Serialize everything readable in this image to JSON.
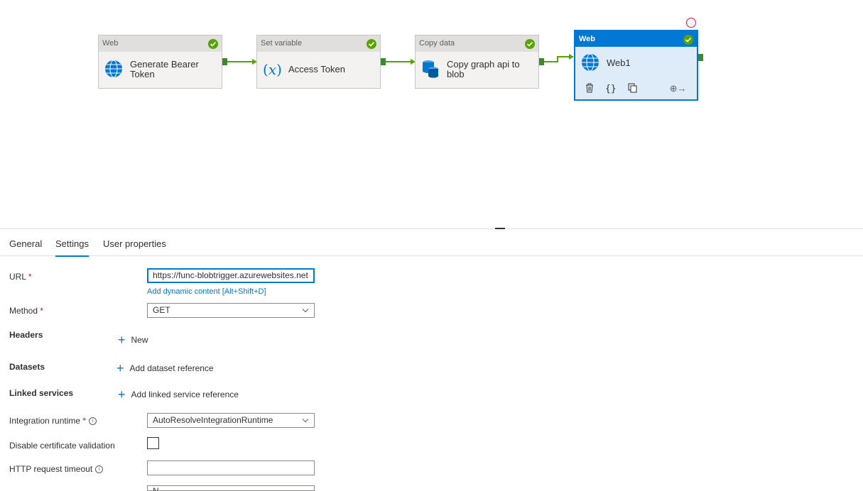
{
  "pipeline": {
    "activities": [
      {
        "type": "Web",
        "name": "Generate Bearer Token",
        "status": "succeeded",
        "icon": "globe-icon"
      },
      {
        "type": "Set variable",
        "name": "Access Token",
        "status": "succeeded",
        "icon": "variable-icon"
      },
      {
        "type": "Copy data",
        "name": "Copy graph api to blob",
        "status": "succeeded",
        "icon": "database-icon"
      },
      {
        "type": "Web",
        "name": "Web1",
        "status": "succeeded",
        "icon": "globe-icon",
        "selected": true
      }
    ],
    "selected_tools": [
      "delete-icon",
      "code-icon",
      "copy-icon",
      "add-output-icon"
    ]
  },
  "tabs": [
    {
      "label": "General"
    },
    {
      "label": "Settings",
      "active": true
    },
    {
      "label": "User properties"
    }
  ],
  "settings": {
    "url": {
      "label": "URL",
      "required": "*",
      "value": "https://func-blobtrigger.azurewebsites.net",
      "dynamic_link": "Add dynamic content [Alt+Shift+D]"
    },
    "method": {
      "label": "Method",
      "required": "*",
      "value": "GET"
    },
    "headers": {
      "label": "Headers",
      "add_label": "New"
    },
    "datasets": {
      "label": "Datasets",
      "add_label": "Add dataset reference"
    },
    "linked_services": {
      "label": "Linked services",
      "add_label": "Add linked service reference"
    },
    "integration_runtime": {
      "label": "Integration runtime",
      "required": "*",
      "value": "AutoResolveIntegrationRuntime"
    },
    "disable_cert": {
      "label": "Disable certificate validation",
      "checked": false
    },
    "http_timeout": {
      "label": "HTTP request timeout",
      "value": ""
    },
    "authentication": {
      "value": "N"
    }
  },
  "colors": {
    "accent": "#0078d4",
    "success": "#57a300",
    "required": "#a4262c"
  }
}
